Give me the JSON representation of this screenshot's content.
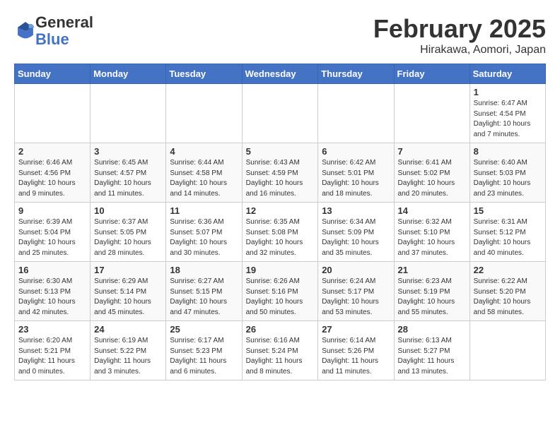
{
  "logo": {
    "general": "General",
    "blue": "Blue"
  },
  "title": "February 2025",
  "location": "Hirakawa, Aomori, Japan",
  "days_of_week": [
    "Sunday",
    "Monday",
    "Tuesday",
    "Wednesday",
    "Thursday",
    "Friday",
    "Saturday"
  ],
  "weeks": [
    [
      {
        "day": "",
        "info": ""
      },
      {
        "day": "",
        "info": ""
      },
      {
        "day": "",
        "info": ""
      },
      {
        "day": "",
        "info": ""
      },
      {
        "day": "",
        "info": ""
      },
      {
        "day": "",
        "info": ""
      },
      {
        "day": "1",
        "info": "Sunrise: 6:47 AM\nSunset: 4:54 PM\nDaylight: 10 hours and 7 minutes."
      }
    ],
    [
      {
        "day": "2",
        "info": "Sunrise: 6:46 AM\nSunset: 4:56 PM\nDaylight: 10 hours and 9 minutes."
      },
      {
        "day": "3",
        "info": "Sunrise: 6:45 AM\nSunset: 4:57 PM\nDaylight: 10 hours and 11 minutes."
      },
      {
        "day": "4",
        "info": "Sunrise: 6:44 AM\nSunset: 4:58 PM\nDaylight: 10 hours and 14 minutes."
      },
      {
        "day": "5",
        "info": "Sunrise: 6:43 AM\nSunset: 4:59 PM\nDaylight: 10 hours and 16 minutes."
      },
      {
        "day": "6",
        "info": "Sunrise: 6:42 AM\nSunset: 5:01 PM\nDaylight: 10 hours and 18 minutes."
      },
      {
        "day": "7",
        "info": "Sunrise: 6:41 AM\nSunset: 5:02 PM\nDaylight: 10 hours and 20 minutes."
      },
      {
        "day": "8",
        "info": "Sunrise: 6:40 AM\nSunset: 5:03 PM\nDaylight: 10 hours and 23 minutes."
      }
    ],
    [
      {
        "day": "9",
        "info": "Sunrise: 6:39 AM\nSunset: 5:04 PM\nDaylight: 10 hours and 25 minutes."
      },
      {
        "day": "10",
        "info": "Sunrise: 6:37 AM\nSunset: 5:05 PM\nDaylight: 10 hours and 28 minutes."
      },
      {
        "day": "11",
        "info": "Sunrise: 6:36 AM\nSunset: 5:07 PM\nDaylight: 10 hours and 30 minutes."
      },
      {
        "day": "12",
        "info": "Sunrise: 6:35 AM\nSunset: 5:08 PM\nDaylight: 10 hours and 32 minutes."
      },
      {
        "day": "13",
        "info": "Sunrise: 6:34 AM\nSunset: 5:09 PM\nDaylight: 10 hours and 35 minutes."
      },
      {
        "day": "14",
        "info": "Sunrise: 6:32 AM\nSunset: 5:10 PM\nDaylight: 10 hours and 37 minutes."
      },
      {
        "day": "15",
        "info": "Sunrise: 6:31 AM\nSunset: 5:12 PM\nDaylight: 10 hours and 40 minutes."
      }
    ],
    [
      {
        "day": "16",
        "info": "Sunrise: 6:30 AM\nSunset: 5:13 PM\nDaylight: 10 hours and 42 minutes."
      },
      {
        "day": "17",
        "info": "Sunrise: 6:29 AM\nSunset: 5:14 PM\nDaylight: 10 hours and 45 minutes."
      },
      {
        "day": "18",
        "info": "Sunrise: 6:27 AM\nSunset: 5:15 PM\nDaylight: 10 hours and 47 minutes."
      },
      {
        "day": "19",
        "info": "Sunrise: 6:26 AM\nSunset: 5:16 PM\nDaylight: 10 hours and 50 minutes."
      },
      {
        "day": "20",
        "info": "Sunrise: 6:24 AM\nSunset: 5:17 PM\nDaylight: 10 hours and 53 minutes."
      },
      {
        "day": "21",
        "info": "Sunrise: 6:23 AM\nSunset: 5:19 PM\nDaylight: 10 hours and 55 minutes."
      },
      {
        "day": "22",
        "info": "Sunrise: 6:22 AM\nSunset: 5:20 PM\nDaylight: 10 hours and 58 minutes."
      }
    ],
    [
      {
        "day": "23",
        "info": "Sunrise: 6:20 AM\nSunset: 5:21 PM\nDaylight: 11 hours and 0 minutes."
      },
      {
        "day": "24",
        "info": "Sunrise: 6:19 AM\nSunset: 5:22 PM\nDaylight: 11 hours and 3 minutes."
      },
      {
        "day": "25",
        "info": "Sunrise: 6:17 AM\nSunset: 5:23 PM\nDaylight: 11 hours and 6 minutes."
      },
      {
        "day": "26",
        "info": "Sunrise: 6:16 AM\nSunset: 5:24 PM\nDaylight: 11 hours and 8 minutes."
      },
      {
        "day": "27",
        "info": "Sunrise: 6:14 AM\nSunset: 5:26 PM\nDaylight: 11 hours and 11 minutes."
      },
      {
        "day": "28",
        "info": "Sunrise: 6:13 AM\nSunset: 5:27 PM\nDaylight: 11 hours and 13 minutes."
      },
      {
        "day": "",
        "info": ""
      }
    ]
  ]
}
